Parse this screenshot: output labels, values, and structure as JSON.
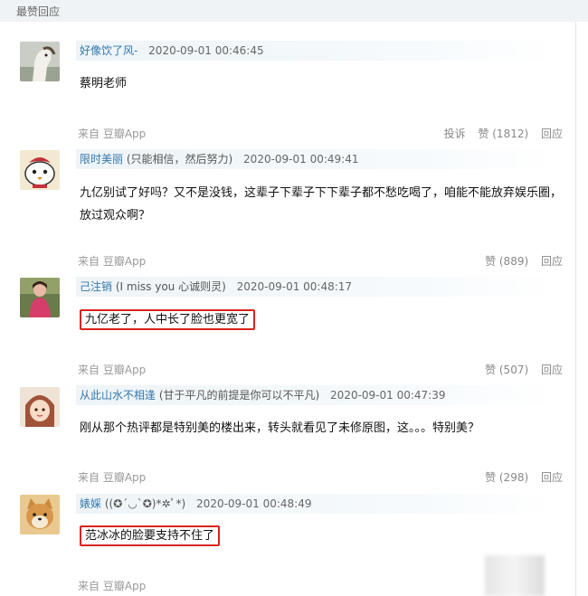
{
  "section": {
    "title": "最赞回应"
  },
  "comments": [
    {
      "username": "好像饮了风-",
      "signature": "",
      "timestamp": "2020-09-01 00:46:45",
      "content": "蔡明老师",
      "source": "来自 豆瓣App",
      "report_label": "投诉",
      "like_label": "赞 (1812)",
      "reply_label": "回应",
      "avatar_icon": "horse-icon"
    },
    {
      "username": "限时美丽",
      "signature": "(只能相信，然后努力)",
      "timestamp": "2020-09-01 00:49:41",
      "content": "九亿别试了好吗？又不是没钱，这辈子下辈子下下辈子都不愁吃喝了，咱能不能放弃娱乐圈，放过观众啊？",
      "source": "来自 豆瓣App",
      "like_label": "赞 (889)",
      "reply_label": "回应",
      "avatar_icon": "cartoon-bird-icon"
    },
    {
      "username": "己注销",
      "signature": "(I miss you 心诚则灵)",
      "timestamp": "2020-09-01 00:48:17",
      "content": "九亿老了，人中长了脸也更宽了",
      "source": "来自 豆瓣App",
      "like_label": "赞 (507)",
      "reply_label": "回应",
      "avatar_icon": "person-photo-icon"
    },
    {
      "username": "从此山水不相逢",
      "signature": "(甘于平凡的前提是你可以不平凡)",
      "timestamp": "2020-09-01 00:47:39",
      "content": "刚从那个热评都是特别美的楼出来，转头就看见了未修原图，这。。。特别美？",
      "source": "来自 豆瓣App",
      "like_label": "赞 (298)",
      "reply_label": "回应",
      "avatar_icon": "anime-girl-icon"
    },
    {
      "username": "婊婇",
      "signature": "((✪´◡`✪)*✲ﾟ*)",
      "timestamp": "2020-09-01 00:48:49",
      "content": "范冰冰的脸要支持不住了",
      "source": "来自 豆瓣App",
      "avatar_icon": "shiba-dog-icon"
    }
  ]
}
